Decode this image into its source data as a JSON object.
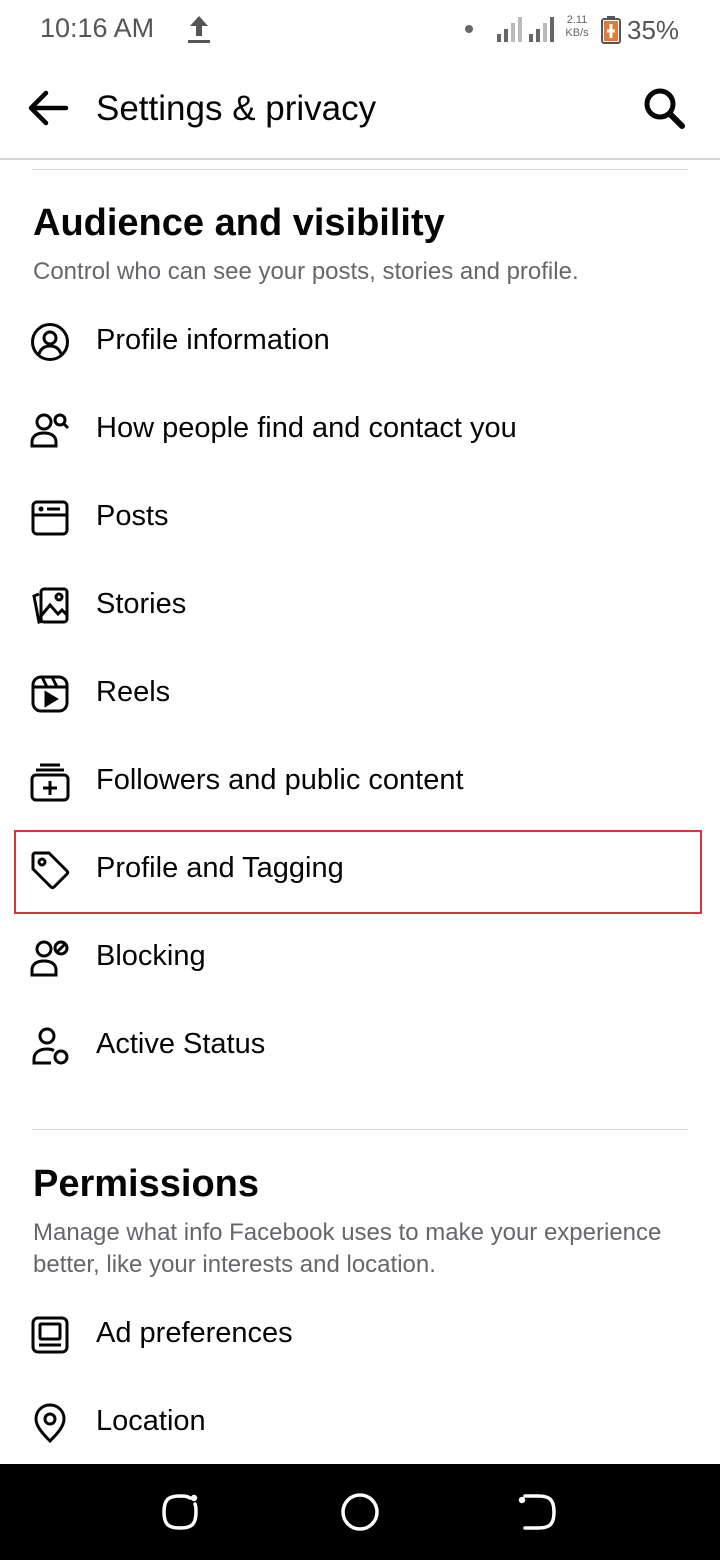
{
  "status_bar": {
    "time": "10:16 AM",
    "speed_value": "2.11",
    "speed_unit": "KB/s",
    "battery_percent": "35%",
    "icons": [
      "upload-icon",
      "dot-icon",
      "signal-icon",
      "battery-icon"
    ]
  },
  "header": {
    "title": "Settings & privacy",
    "icons": [
      "back-arrow-icon",
      "search-icon"
    ]
  },
  "audience": {
    "title": "Audience and visibility",
    "description": "Control who can see your posts, stories and profile.",
    "items": [
      {
        "label": "Profile information",
        "icon": "profile-circle-icon"
      },
      {
        "label": "How people find and contact you",
        "icon": "people-search-icon"
      },
      {
        "label": "Posts",
        "icon": "post-card-icon"
      },
      {
        "label": "Stories",
        "icon": "stories-icon"
      },
      {
        "label": "Reels",
        "icon": "reels-icon"
      },
      {
        "label": "Followers and public content",
        "icon": "followers-icon"
      },
      {
        "label": "Profile and Tagging",
        "icon": "tag-icon",
        "highlighted": true
      },
      {
        "label": "Blocking",
        "icon": "person-block-icon"
      },
      {
        "label": "Active Status",
        "icon": "person-status-icon"
      }
    ]
  },
  "permissions": {
    "title": "Permissions",
    "description": "Manage what info Facebook uses to make your experience better, like your interests and location.",
    "items": [
      {
        "label": "Ad preferences",
        "icon": "ad-preferences-icon"
      },
      {
        "label": "Location",
        "icon": "location-pin-icon"
      }
    ]
  },
  "nav_bar": {
    "icons": [
      "recent-apps-icon",
      "home-icon",
      "back-icon"
    ]
  },
  "colors": {
    "text": "#050505",
    "secondary_text": "#65676b",
    "highlight_border": "#d6353b",
    "nav_background": "#000000"
  }
}
